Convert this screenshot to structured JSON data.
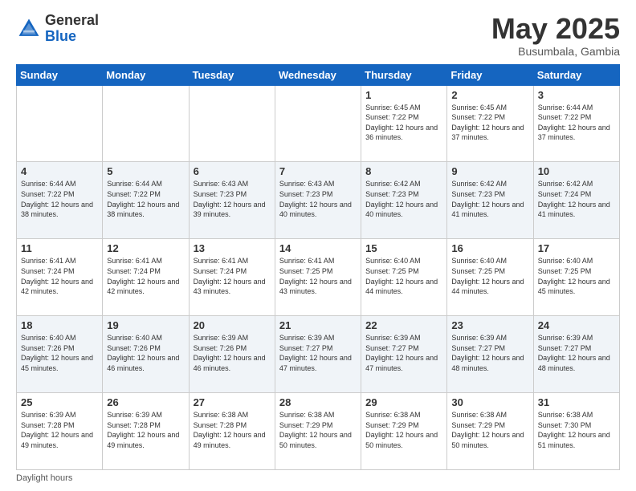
{
  "logo": {
    "general": "General",
    "blue": "Blue"
  },
  "header": {
    "month": "May 2025",
    "location": "Busumbala, Gambia"
  },
  "weekdays": [
    "Sunday",
    "Monday",
    "Tuesday",
    "Wednesday",
    "Thursday",
    "Friday",
    "Saturday"
  ],
  "weeks": [
    [
      {
        "day": "",
        "info": ""
      },
      {
        "day": "",
        "info": ""
      },
      {
        "day": "",
        "info": ""
      },
      {
        "day": "",
        "info": ""
      },
      {
        "day": "1",
        "info": "Sunrise: 6:45 AM\nSunset: 7:22 PM\nDaylight: 12 hours\nand 36 minutes."
      },
      {
        "day": "2",
        "info": "Sunrise: 6:45 AM\nSunset: 7:22 PM\nDaylight: 12 hours\nand 37 minutes."
      },
      {
        "day": "3",
        "info": "Sunrise: 6:44 AM\nSunset: 7:22 PM\nDaylight: 12 hours\nand 37 minutes."
      }
    ],
    [
      {
        "day": "4",
        "info": "Sunrise: 6:44 AM\nSunset: 7:22 PM\nDaylight: 12 hours\nand 38 minutes."
      },
      {
        "day": "5",
        "info": "Sunrise: 6:44 AM\nSunset: 7:22 PM\nDaylight: 12 hours\nand 38 minutes."
      },
      {
        "day": "6",
        "info": "Sunrise: 6:43 AM\nSunset: 7:23 PM\nDaylight: 12 hours\nand 39 minutes."
      },
      {
        "day": "7",
        "info": "Sunrise: 6:43 AM\nSunset: 7:23 PM\nDaylight: 12 hours\nand 40 minutes."
      },
      {
        "day": "8",
        "info": "Sunrise: 6:42 AM\nSunset: 7:23 PM\nDaylight: 12 hours\nand 40 minutes."
      },
      {
        "day": "9",
        "info": "Sunrise: 6:42 AM\nSunset: 7:23 PM\nDaylight: 12 hours\nand 41 minutes."
      },
      {
        "day": "10",
        "info": "Sunrise: 6:42 AM\nSunset: 7:24 PM\nDaylight: 12 hours\nand 41 minutes."
      }
    ],
    [
      {
        "day": "11",
        "info": "Sunrise: 6:41 AM\nSunset: 7:24 PM\nDaylight: 12 hours\nand 42 minutes."
      },
      {
        "day": "12",
        "info": "Sunrise: 6:41 AM\nSunset: 7:24 PM\nDaylight: 12 hours\nand 42 minutes."
      },
      {
        "day": "13",
        "info": "Sunrise: 6:41 AM\nSunset: 7:24 PM\nDaylight: 12 hours\nand 43 minutes."
      },
      {
        "day": "14",
        "info": "Sunrise: 6:41 AM\nSunset: 7:25 PM\nDaylight: 12 hours\nand 43 minutes."
      },
      {
        "day": "15",
        "info": "Sunrise: 6:40 AM\nSunset: 7:25 PM\nDaylight: 12 hours\nand 44 minutes."
      },
      {
        "day": "16",
        "info": "Sunrise: 6:40 AM\nSunset: 7:25 PM\nDaylight: 12 hours\nand 44 minutes."
      },
      {
        "day": "17",
        "info": "Sunrise: 6:40 AM\nSunset: 7:25 PM\nDaylight: 12 hours\nand 45 minutes."
      }
    ],
    [
      {
        "day": "18",
        "info": "Sunrise: 6:40 AM\nSunset: 7:26 PM\nDaylight: 12 hours\nand 45 minutes."
      },
      {
        "day": "19",
        "info": "Sunrise: 6:40 AM\nSunset: 7:26 PM\nDaylight: 12 hours\nand 46 minutes."
      },
      {
        "day": "20",
        "info": "Sunrise: 6:39 AM\nSunset: 7:26 PM\nDaylight: 12 hours\nand 46 minutes."
      },
      {
        "day": "21",
        "info": "Sunrise: 6:39 AM\nSunset: 7:27 PM\nDaylight: 12 hours\nand 47 minutes."
      },
      {
        "day": "22",
        "info": "Sunrise: 6:39 AM\nSunset: 7:27 PM\nDaylight: 12 hours\nand 47 minutes."
      },
      {
        "day": "23",
        "info": "Sunrise: 6:39 AM\nSunset: 7:27 PM\nDaylight: 12 hours\nand 48 minutes."
      },
      {
        "day": "24",
        "info": "Sunrise: 6:39 AM\nSunset: 7:27 PM\nDaylight: 12 hours\nand 48 minutes."
      }
    ],
    [
      {
        "day": "25",
        "info": "Sunrise: 6:39 AM\nSunset: 7:28 PM\nDaylight: 12 hours\nand 49 minutes."
      },
      {
        "day": "26",
        "info": "Sunrise: 6:39 AM\nSunset: 7:28 PM\nDaylight: 12 hours\nand 49 minutes."
      },
      {
        "day": "27",
        "info": "Sunrise: 6:38 AM\nSunset: 7:28 PM\nDaylight: 12 hours\nand 49 minutes."
      },
      {
        "day": "28",
        "info": "Sunrise: 6:38 AM\nSunset: 7:29 PM\nDaylight: 12 hours\nand 50 minutes."
      },
      {
        "day": "29",
        "info": "Sunrise: 6:38 AM\nSunset: 7:29 PM\nDaylight: 12 hours\nand 50 minutes."
      },
      {
        "day": "30",
        "info": "Sunrise: 6:38 AM\nSunset: 7:29 PM\nDaylight: 12 hours\nand 50 minutes."
      },
      {
        "day": "31",
        "info": "Sunrise: 6:38 AM\nSunset: 7:30 PM\nDaylight: 12 hours\nand 51 minutes."
      }
    ]
  ],
  "footer": {
    "daylight_label": "Daylight hours"
  }
}
